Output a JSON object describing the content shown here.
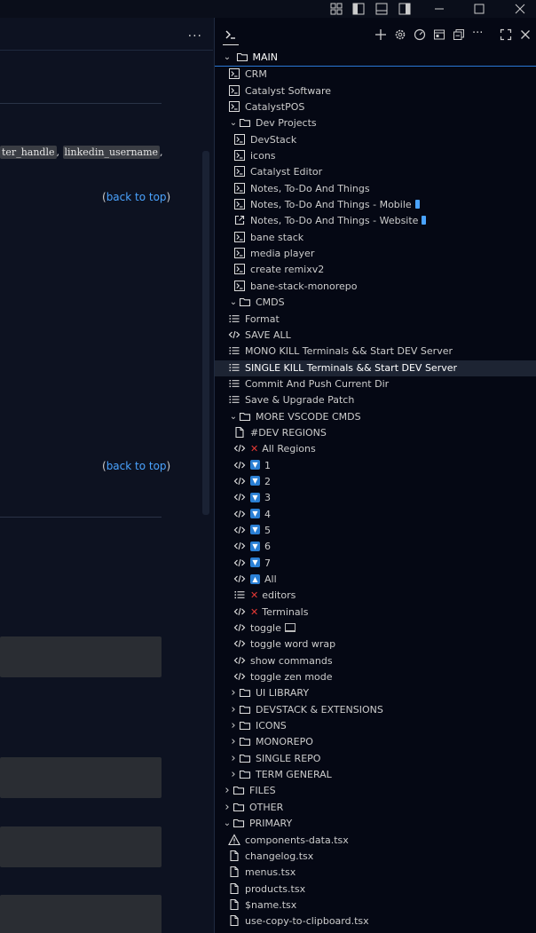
{
  "left": {
    "code_parts": [
      "ter_handle",
      ", ",
      "linkedin_username",
      ","
    ],
    "back_to_top_1": "back to top",
    "back_to_top_2": "back to top",
    "paren_open": "(",
    "paren_close": ")"
  },
  "panel": {
    "root_label": "MAIN",
    "items": [
      {
        "label": "CRM",
        "icon": "terminal-icon",
        "indent": 1
      },
      {
        "label": "Catalyst Software",
        "icon": "terminal-icon",
        "indent": 1
      },
      {
        "label": "CatalystPOS",
        "icon": "terminal-icon",
        "indent": 1
      },
      {
        "label": "Dev Projects",
        "icon": "folder-icon",
        "indent": 1,
        "chevron": "down"
      },
      {
        "label": "DevStack",
        "icon": "terminal-icon",
        "indent": 2
      },
      {
        "label": "icons",
        "icon": "terminal-icon",
        "indent": 2
      },
      {
        "label": "Catalyst Editor",
        "icon": "terminal-icon",
        "indent": 2
      },
      {
        "label": "Notes, To-Do And Things",
        "icon": "terminal-icon",
        "indent": 2
      },
      {
        "label": "Notes, To-Do And Things - Mobile",
        "icon": "terminal-icon",
        "indent": 2,
        "suffix": "phone"
      },
      {
        "label": "Notes, To-Do And Things - Website",
        "icon": "external-link-icon",
        "indent": 2,
        "suffix": "phone"
      },
      {
        "label": "bane stack",
        "icon": "terminal-icon",
        "indent": 2
      },
      {
        "label": "media player",
        "icon": "terminal-icon",
        "indent": 2
      },
      {
        "label": "create remixv2",
        "icon": "terminal-icon",
        "indent": 2
      },
      {
        "label": "bane-stack-monorepo",
        "icon": "terminal-icon",
        "indent": 2
      },
      {
        "label": "CMDS",
        "icon": "folder-icon",
        "indent": 1,
        "chevron": "down"
      },
      {
        "label": "Format",
        "icon": "list-icon",
        "indent": 1
      },
      {
        "label": "SAVE ALL",
        "icon": "code-icon",
        "indent": 1
      },
      {
        "label": "MONO KILL Terminals && Start DEV Server",
        "icon": "list-icon",
        "indent": 1
      },
      {
        "label": "SINGLE KILL Terminals && Start DEV Server",
        "icon": "list-icon",
        "indent": 1,
        "selected": true
      },
      {
        "label": "Commit And Push Current Dir",
        "icon": "list-icon",
        "indent": 1
      },
      {
        "label": "Save & Upgrade Patch",
        "icon": "list-icon",
        "indent": 1
      },
      {
        "label": "MORE VSCODE CMDS",
        "icon": "folder-icon",
        "indent": 1,
        "chevron": "down"
      },
      {
        "label": "#DEV REGIONS",
        "icon": "file-icon",
        "indent": 2
      },
      {
        "label": "All Regions",
        "icon": "code-icon",
        "indent": 2,
        "prefix": "x"
      },
      {
        "label": "1",
        "icon": "code-icon",
        "indent": 2,
        "prefix": "down"
      },
      {
        "label": "2",
        "icon": "code-icon",
        "indent": 2,
        "prefix": "down"
      },
      {
        "label": "3",
        "icon": "code-icon",
        "indent": 2,
        "prefix": "down"
      },
      {
        "label": "4",
        "icon": "code-icon",
        "indent": 2,
        "prefix": "down"
      },
      {
        "label": "5",
        "icon": "code-icon",
        "indent": 2,
        "prefix": "down"
      },
      {
        "label": "6",
        "icon": "code-icon",
        "indent": 2,
        "prefix": "down"
      },
      {
        "label": "7",
        "icon": "code-icon",
        "indent": 2,
        "prefix": "down"
      },
      {
        "label": "All",
        "icon": "code-icon",
        "indent": 2,
        "prefix": "up"
      },
      {
        "label": "editors",
        "icon": "list-icon",
        "indent": 2,
        "prefix": "x"
      },
      {
        "label": "Terminals",
        "icon": "code-icon",
        "indent": 2,
        "prefix": "x"
      },
      {
        "label": "toggle",
        "icon": "code-icon",
        "indent": 2,
        "suffix": "laptop"
      },
      {
        "label": "toggle word wrap",
        "icon": "code-icon",
        "indent": 2
      },
      {
        "label": "show commands",
        "icon": "code-icon",
        "indent": 2
      },
      {
        "label": "toggle zen mode",
        "icon": "code-icon",
        "indent": 2
      },
      {
        "label": "UI LIBRARY",
        "icon": "folder-icon",
        "indent": 1,
        "chevron": "right"
      },
      {
        "label": "DEVSTACK & EXTENSIONS",
        "icon": "folder-icon",
        "indent": 1,
        "chevron": "right"
      },
      {
        "label": "ICONS",
        "icon": "folder-icon",
        "indent": 1,
        "chevron": "right"
      },
      {
        "label": "MONOREPO",
        "icon": "folder-icon",
        "indent": 1,
        "chevron": "right"
      },
      {
        "label": "SINGLE REPO",
        "icon": "folder-icon",
        "indent": 1,
        "chevron": "right"
      },
      {
        "label": "TERM GENERAL",
        "icon": "folder-icon",
        "indent": 1,
        "chevron": "right"
      },
      {
        "label": "FILES",
        "icon": "folder-icon",
        "indent": 0,
        "chevron": "right"
      },
      {
        "label": "OTHER",
        "icon": "folder-icon",
        "indent": 0,
        "chevron": "right"
      },
      {
        "label": "PRIMARY",
        "icon": "folder-icon",
        "indent": 0,
        "chevron": "down"
      },
      {
        "label": "components-data.tsx",
        "icon": "warning-icon",
        "indent": 1
      },
      {
        "label": "changelog.tsx",
        "icon": "file-icon",
        "indent": 1
      },
      {
        "label": "menus.tsx",
        "icon": "file-icon",
        "indent": 1
      },
      {
        "label": "products.tsx",
        "icon": "file-icon",
        "indent": 1
      },
      {
        "label": "$name.tsx",
        "icon": "file-icon",
        "indent": 1
      },
      {
        "label": "use-copy-to-clipboard.tsx",
        "icon": "file-icon",
        "indent": 1
      }
    ]
  },
  "colors": {
    "accent": "#2a78d6",
    "link": "#4aa3ff",
    "x_red": "#e53935",
    "badge_blue": "#2a7fd4"
  }
}
